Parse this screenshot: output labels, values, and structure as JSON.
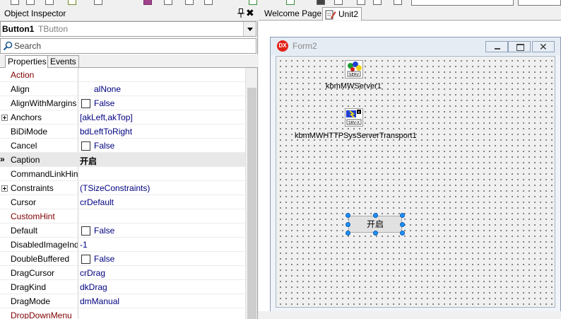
{
  "object_inspector": {
    "title": "Object Inspector",
    "component_name": "Button1",
    "component_type": "TButton",
    "search_placeholder": "Search",
    "tabs": [
      "Properties",
      "Events"
    ],
    "properties": [
      {
        "name": "Action",
        "value": "",
        "category": true
      },
      {
        "name": "Align",
        "value": "alNone",
        "indent": true
      },
      {
        "name": "AlignWithMargins",
        "value": "False",
        "checkbox": true
      },
      {
        "name": "Anchors",
        "value": "[akLeft,akTop]",
        "expandable": true
      },
      {
        "name": "BiDiMode",
        "value": "bdLeftToRight"
      },
      {
        "name": "Cancel",
        "value": "False",
        "checkbox": true
      },
      {
        "name": "Caption",
        "value": "开启",
        "selected": true,
        "bold": true
      },
      {
        "name": "CommandLinkHint",
        "value": ""
      },
      {
        "name": "Constraints",
        "value": "(TSizeConstraints)",
        "expandable": true
      },
      {
        "name": "Cursor",
        "value": "crDefault"
      },
      {
        "name": "CustomHint",
        "value": "",
        "category": true
      },
      {
        "name": "Default",
        "value": "False",
        "checkbox": true
      },
      {
        "name": "DisabledImageIndex",
        "value": "-1"
      },
      {
        "name": "DoubleBuffered",
        "value": "False",
        "checkbox": true
      },
      {
        "name": "DragCursor",
        "value": "crDrag"
      },
      {
        "name": "DragKind",
        "value": "dkDrag"
      },
      {
        "name": "DragMode",
        "value": "dmManual"
      },
      {
        "name": "DropDownMenu",
        "value": "",
        "category": true
      }
    ]
  },
  "designer": {
    "tabs": {
      "welcome": "Welcome Page",
      "unit": "Unit2"
    },
    "form_title": "Form2",
    "components": [
      {
        "label": "kbmMWServer1",
        "icon": "server-icon"
      },
      {
        "label": "kbmMWHTTPSysServerTransport1",
        "icon": "transport-icon"
      }
    ],
    "button_caption": "开启"
  },
  "colors": {
    "category_text": "#800000",
    "value_text": "#000080",
    "selection_handle": "#1e90ff",
    "dx_logo": "#e32119"
  }
}
